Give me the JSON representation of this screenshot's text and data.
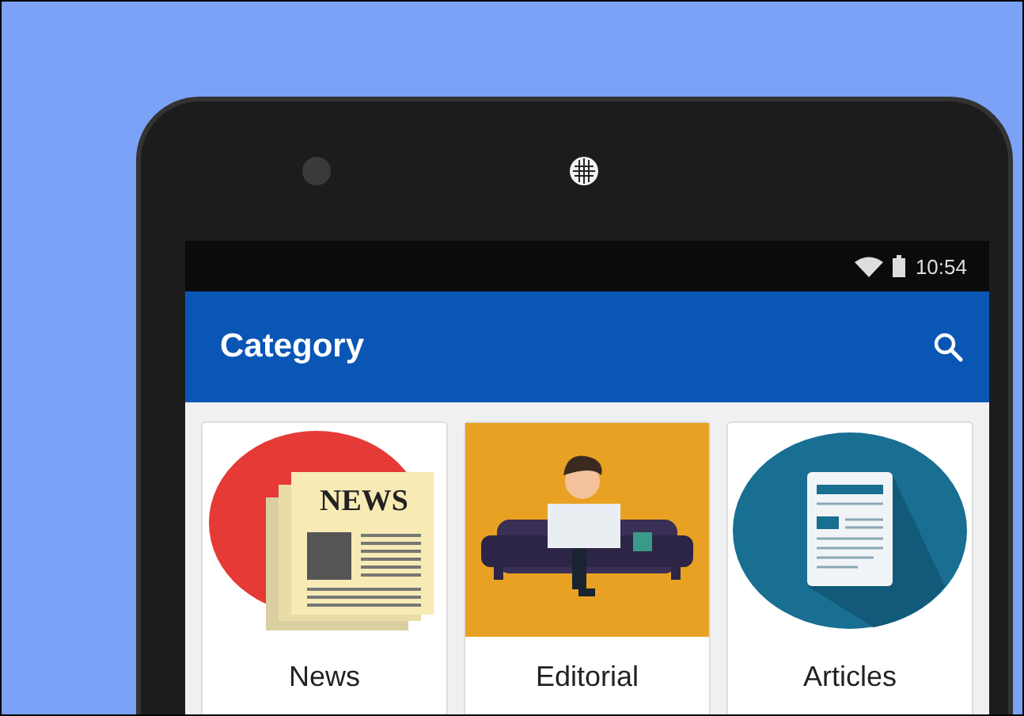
{
  "status_bar": {
    "time": "10:54"
  },
  "app_bar": {
    "title": "Category"
  },
  "categories": [
    {
      "kind": "newspaper",
      "label": "News",
      "art_text": "NEWS"
    },
    {
      "kind": "reader",
      "label": "Editorial"
    },
    {
      "kind": "document",
      "label": "Articles"
    }
  ]
}
